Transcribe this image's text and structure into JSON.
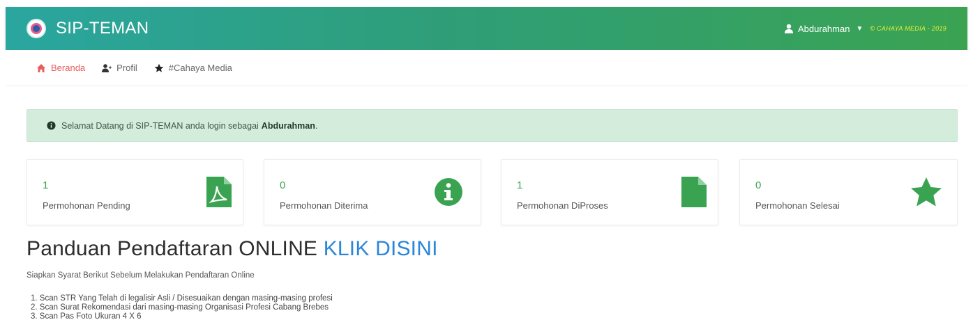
{
  "header": {
    "brand": "SIP-TEMAN",
    "user_name": "Abdurahman",
    "copyright": "© CAHAYA MEDIA - 2019"
  },
  "nav": {
    "items": [
      {
        "label": "Beranda",
        "icon": "home-icon",
        "active": true
      },
      {
        "label": "Profil",
        "icon": "user-plus-icon",
        "active": false
      },
      {
        "label": "#Cahaya Media",
        "icon": "star-icon",
        "active": false
      }
    ]
  },
  "alert": {
    "message": "Selamat Datang di SIP-TEMAN anda login sebagai",
    "user": "Abdurahman",
    "suffix": "."
  },
  "stats": [
    {
      "count": "1",
      "label": "Permohonan Pending",
      "icon": "file-pdf-icon"
    },
    {
      "count": "0",
      "label": "Permohonan Diterima",
      "icon": "info-circle-icon"
    },
    {
      "count": "1",
      "label": "Permohonan DiProses",
      "icon": "file-icon"
    },
    {
      "count": "0",
      "label": "Permohonan Selesai",
      "icon": "star-icon"
    }
  ],
  "guide": {
    "title": "Panduan Pendaftaran ONLINE",
    "link": "KLIK DISINI",
    "subtitle": "Siapkan Syarat Berikut Sebelum Melakukan Pendaftaran Online",
    "requirements": [
      "1. Scan STR Yang Telah di legalisir Asli / Disesuaikan dengan masing-masing profesi",
      "2. Scan Surat Rekomendasi dari masing-masing Organisasi Profesi Cabang Brebes",
      "3. Scan Pas Foto Ukuran 4 X 6"
    ]
  },
  "colors": {
    "accent_green": "#3aa352",
    "link_blue": "#2b86d8",
    "active_nav": "#e85d5d",
    "alert_bg": "#d4ecdb"
  }
}
